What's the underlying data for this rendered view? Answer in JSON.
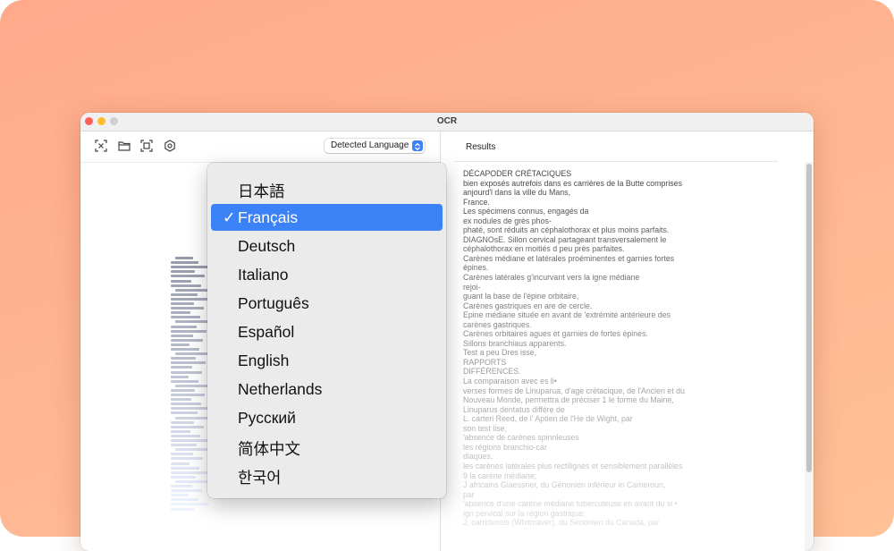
{
  "window": {
    "title": "OCR"
  },
  "toolbar": {
    "icons": [
      "scan-region-icon",
      "open-folder-icon",
      "capture-screen-icon",
      "settings-gear-icon"
    ],
    "language_select": {
      "label": "Detected Language"
    }
  },
  "results": {
    "label": "Results",
    "lines": [
      "DÉCAPODER CRÉTACIQUES",
      "bien exposés autrefois dans es carrières de la Butte comprises",
      "anjourd'l dans la ville du Mans,",
      "France.",
      "Les spécimens connus, engagés da",
      "ex nodules de grès phos-",
      "phaté, sont réduits an céphalothorax et plus moins parfaits.",
      "DIAGNOsE. Sillon cervical partageant transversalement le",
      "céphalothorax en moitiés d peu près parfaites.",
      "Carènes médiane et latérales proéminentes et garnies fortes",
      "épines.",
      "Carènes latérales g'incurvant vers la igne médiane",
      "rejoi-",
      "guant la base de l'épine orbitaire,",
      "Carènes gastriques en are de cercle.",
      "Epine médiane située en avant de 'extrémité antérieure des",
      "carènes gastriques.",
      "Carènes orbitaires agues et garnies de fortes épines.",
      "Sillons branchiaus apparents.",
      "Test a peu Dres isse,",
      "RAPPORTS",
      "DIFFÉRENCES.",
      "La comparaison avec es li•",
      "verses formes de Linuparua, d'age crétacique, de l'Ancien et du",
      "Nouveau Monde, permettra de préciser 1 le forme du Maine,",
      "Linuparus dentatus diffère de",
      "L. carteri Reed, de l' Aptien de l'He de Wight, par",
      "son test lise,",
      "'absence de carènes spinnleuses",
      "les régions branchio-car",
      "diaques,",
      "les carènes latérales plus rectilignes et sensiblement parallèles",
      "9 la carène médiane;",
      "J africains Glaessner, du Génonien inférieur in Cameroun,",
      "par",
      "'absence d'une carène médiane tuberculeuse en avant du si •",
      "ign pervical sur la région gastrique;",
      "J. carridensis (Whitmaver), du Sénonien du Canada, par"
    ]
  },
  "language_menu": {
    "selected_index": 1,
    "check_glyph": "✓",
    "items": [
      {
        "label": "日本語"
      },
      {
        "label": "Français"
      },
      {
        "label": "Deutsch"
      },
      {
        "label": "Italiano"
      },
      {
        "label": "Português"
      },
      {
        "label": "Español"
      },
      {
        "label": "English"
      },
      {
        "label": "Netherlands"
      },
      {
        "label": "Русский"
      },
      {
        "label": "简体中文"
      },
      {
        "label": "한국어"
      }
    ]
  }
}
